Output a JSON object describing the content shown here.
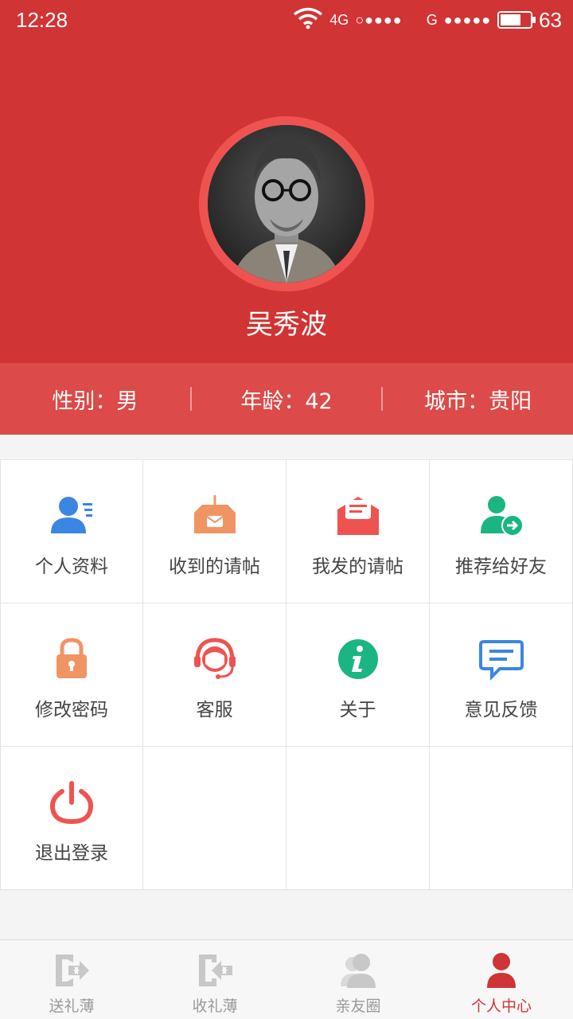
{
  "status_bar": {
    "time": "12:28",
    "network_1": "4G",
    "signal_1": "○●●●●",
    "network_2": "G",
    "signal_2": "●●●●●",
    "battery_level": "63"
  },
  "profile": {
    "name": "吴秀波",
    "gender": "性别：男",
    "age": "年龄：42",
    "city": "城市：贵阳"
  },
  "menu": [
    {
      "label": "个人资料",
      "icon": "user-profile-icon",
      "color": "#3b86e2"
    },
    {
      "label": "收到的请帖",
      "icon": "inbox-invite-icon",
      "color": "#f19463"
    },
    {
      "label": "我发的请帖",
      "icon": "sent-invite-icon",
      "color": "#ef5350"
    },
    {
      "label": "推荐给好友",
      "icon": "recommend-friend-icon",
      "color": "#1ab583"
    },
    {
      "label": "修改密码",
      "icon": "lock-icon",
      "color": "#f19463"
    },
    {
      "label": "客服",
      "icon": "customer-service-icon",
      "color": "#ef5350"
    },
    {
      "label": "关于",
      "icon": "info-icon",
      "color": "#1ab583"
    },
    {
      "label": "意见反馈",
      "icon": "feedback-icon",
      "color": "#3b86e2"
    },
    {
      "label": "退出登录",
      "icon": "power-icon",
      "color": "#ef5350"
    }
  ],
  "tabs": [
    {
      "label": "送礼薄",
      "icon": "send-gift-icon",
      "active": false
    },
    {
      "label": "收礼薄",
      "icon": "receive-gift-icon",
      "active": false
    },
    {
      "label": "亲友圈",
      "icon": "friends-circle-icon",
      "active": false
    },
    {
      "label": "个人中心",
      "icon": "personal-center-icon",
      "active": true
    }
  ],
  "colors": {
    "header": "#d03434",
    "info_bar": "#dc4a49",
    "active_tab": "#d03434",
    "inactive_tab": "#999999"
  }
}
